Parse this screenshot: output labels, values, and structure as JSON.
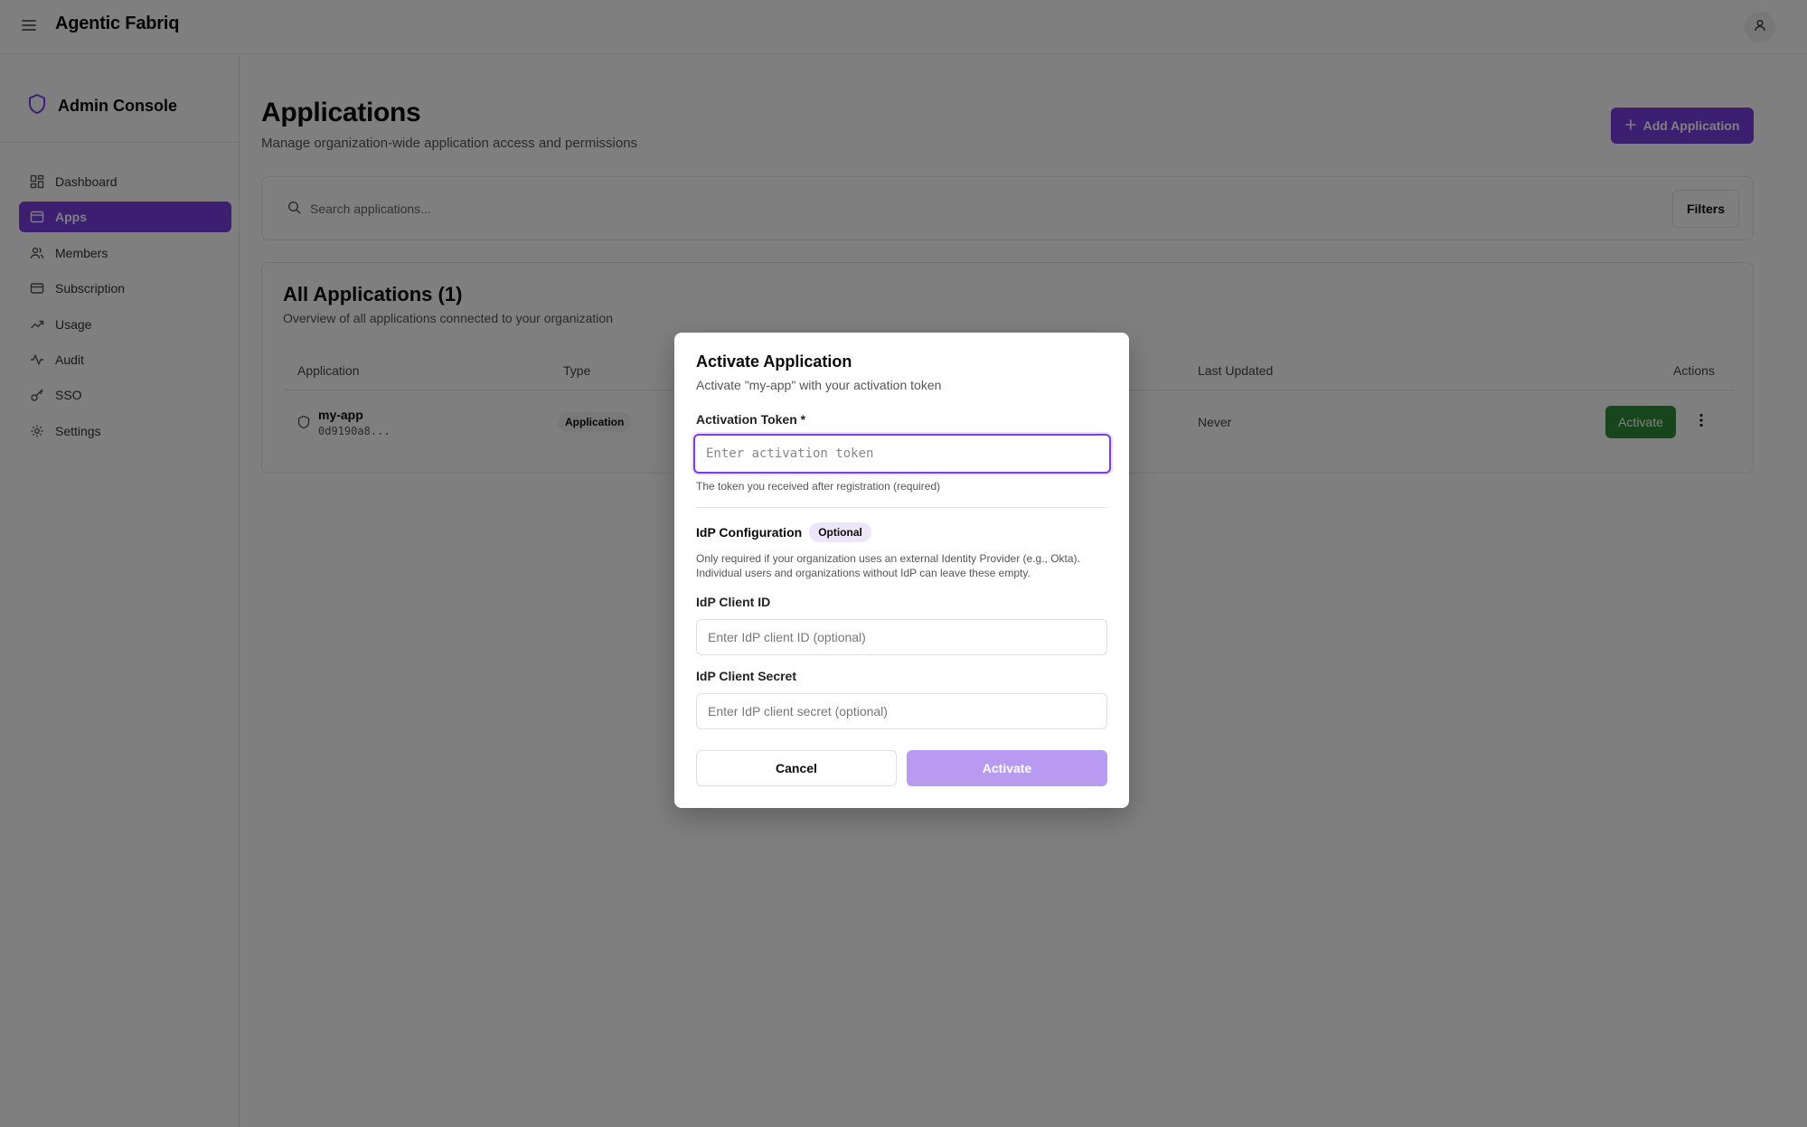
{
  "app": {
    "title": "Agentic Fabriq",
    "menu_icon": "menu-icon",
    "user_icon": "user-icon"
  },
  "sidebar": {
    "title": "Admin Console",
    "title_icon": "shield-icon",
    "items": [
      {
        "label": "Dashboard",
        "icon": "dashboard-icon",
        "active": false
      },
      {
        "label": "Apps",
        "icon": "apps-icon",
        "active": true
      },
      {
        "label": "Members",
        "icon": "members-icon",
        "active": false
      },
      {
        "label": "Subscription",
        "icon": "credit-card-icon",
        "active": false
      },
      {
        "label": "Usage",
        "icon": "trending-up-icon",
        "active": false
      },
      {
        "label": "Audit",
        "icon": "activity-icon",
        "active": false
      },
      {
        "label": "SSO",
        "icon": "key-icon",
        "active": false
      },
      {
        "label": "Settings",
        "icon": "gear-icon",
        "active": false
      }
    ]
  },
  "main": {
    "title": "Applications",
    "subtitle": "Manage organization-wide application access and permissions",
    "add_button": "Add Application",
    "search": {
      "placeholder": "Search applications..."
    },
    "filters_button": "Filters",
    "card": {
      "title": "All Applications (1)",
      "subtitle": "Overview of all applications connected to your organization",
      "columns": {
        "application": "Application",
        "type": "Type",
        "last_updated": "Last Updated",
        "actions": "Actions"
      },
      "rows": [
        {
          "name": "my-app",
          "id": "0d9190a8...",
          "type": "Application",
          "last_updated": "Never",
          "action": "Activate"
        }
      ]
    }
  },
  "modal": {
    "title": "Activate Application",
    "description": "Activate \"my-app\" with your activation token",
    "token_label": "Activation Token *",
    "token_placeholder": "Enter activation token",
    "token_value": "",
    "token_hint": "The token you received after registration (required)",
    "idp_title": "IdP Configuration",
    "optional_badge": "Optional",
    "idp_desc_line1": "Only required if your organization uses an external Identity Provider (e.g., Okta).",
    "idp_desc_line2": "Individual users and organizations without IdP can leave these empty.",
    "client_id_label": "IdP Client ID",
    "client_id_placeholder": "Enter IdP client ID (optional)",
    "client_secret_label": "IdP Client Secret",
    "client_secret_placeholder": "Enter IdP client secret (optional)",
    "cancel_button": "Cancel",
    "activate_button": "Activate"
  },
  "colors": {
    "accent": "#7a3fe4",
    "success": "#2e8d3a",
    "disabled_accent": "#b89af0"
  }
}
